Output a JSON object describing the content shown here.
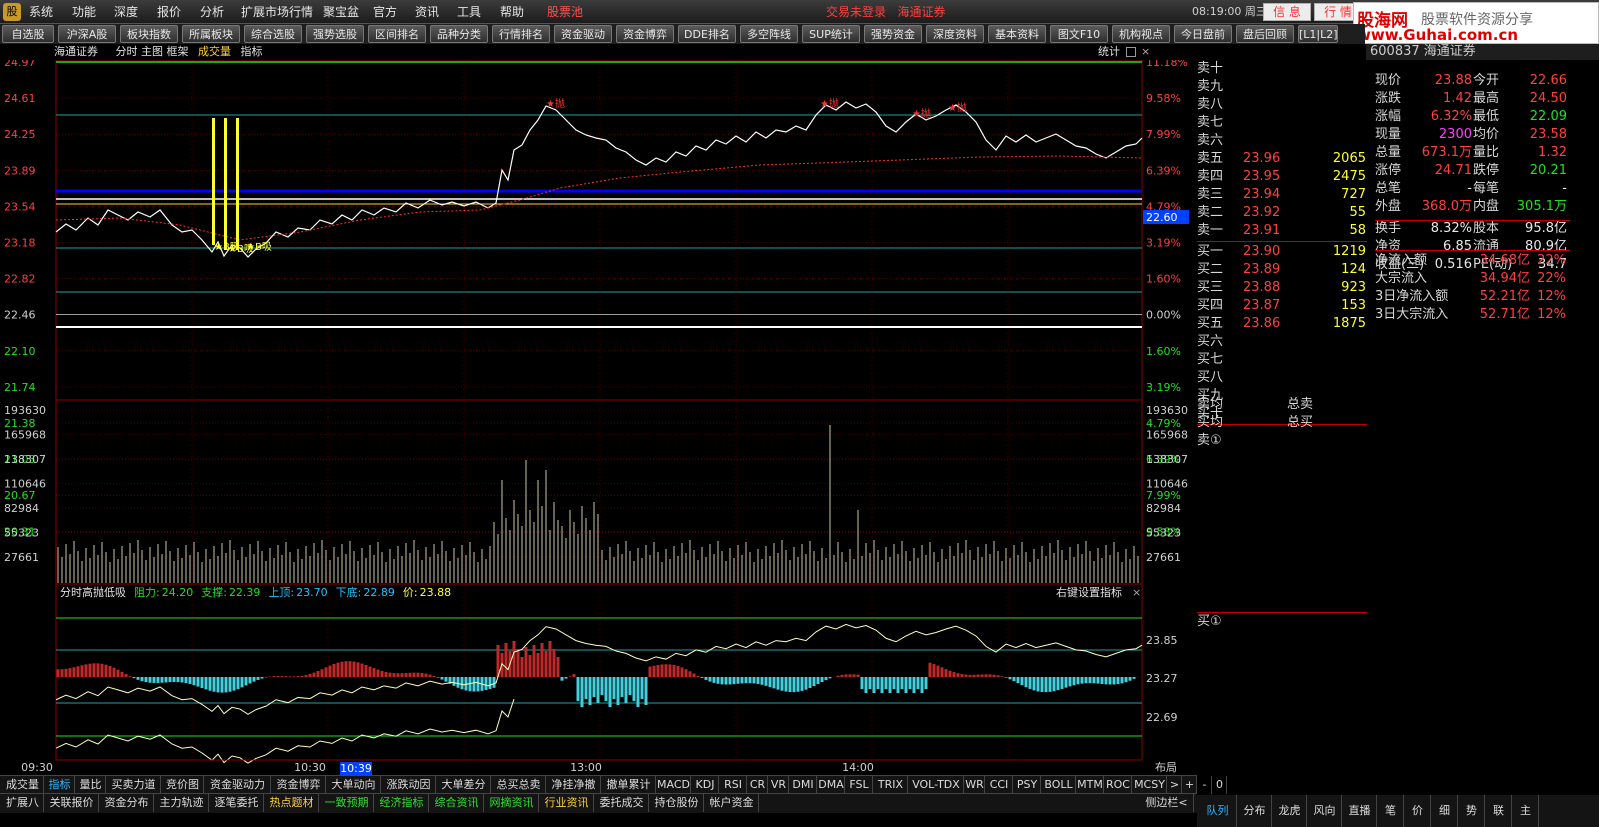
{
  "menubar": {
    "items": [
      "系统",
      "功能",
      "深度",
      "报价",
      "分析",
      "扩展市场行情",
      "聚宝盆",
      "官方",
      "资讯",
      "工具",
      "帮助",
      "股票池"
    ],
    "status": "交易未登录",
    "broker": "海通证券",
    "time": "08:19:00 周三",
    "buttons": [
      "信 息",
      "行 情"
    ]
  },
  "banner": {
    "line1": "股海网",
    "line2": "股票软件资源分享",
    "line3": "www.Guhai.com.cn"
  },
  "toolbar": {
    "items": [
      "自选股",
      "沪深A股",
      "板块指数",
      "所属板块",
      "综合选股",
      "强势选股",
      "区间排名",
      "品种分类",
      "行情排名",
      "资金驱动",
      "资金博弈",
      "DDE排名",
      "多空阵线",
      "SUP统计",
      "强势资金",
      "深度资料",
      "基本资料",
      "图文F10",
      "机构视点",
      "今日盘前",
      "盘后回顾",
      "[L1|L2]"
    ]
  },
  "chart": {
    "stock_name": "海通证券",
    "modes": "分时 主图 框架",
    "volume_label": "成交量",
    "indicator_label": "指标",
    "stat_label": "统计",
    "price_ticks": [
      "24.97",
      "24.61",
      "24.25",
      "23.89",
      "23.54",
      "23.18",
      "22.82",
      "22.46",
      "22.10",
      "21.74",
      "21.38",
      "21.03",
      "20.67",
      "20.31"
    ],
    "pct_ticks": [
      "11.18%",
      "9.58%",
      "7.99%",
      "6.39%",
      "4.79%",
      "3.19%",
      "1.60%",
      "0.00%",
      "1.60%",
      "3.19%",
      "4.79%",
      "6.39%",
      "7.99%",
      "9.58%"
    ],
    "current_price_tag": "22.60",
    "vol_ticks": [
      "193630",
      "165968",
      "138307",
      "110646",
      "82984",
      "55323",
      "27661"
    ],
    "time_ticks": [
      "09:30",
      "10:30",
      "13:00",
      "14:00"
    ],
    "cursor_time": "10:39",
    "layout_btn": "布局",
    "signals": {
      "buy": "B吸",
      "sell": "抛"
    }
  },
  "indicator": {
    "name": "分时高抛低吸",
    "resist_label": "阻力:",
    "resist": "24.20",
    "support_label": "支撑:",
    "support": "22.39",
    "top_label": "上顶:",
    "top": "23.70",
    "bottom_label": "下底:",
    "bottom": "22.89",
    "price_label": "价:",
    "price": "23.88",
    "right_label": "右键设置指标",
    "close": "×",
    "levels": [
      "23.85",
      "23.27",
      "22.69"
    ]
  },
  "orderbook": {
    "sell": [
      {
        "label": "卖十",
        "price": "",
        "vol": ""
      },
      {
        "label": "卖九",
        "price": "",
        "vol": ""
      },
      {
        "label": "卖八",
        "price": "",
        "vol": ""
      },
      {
        "label": "卖七",
        "price": "",
        "vol": ""
      },
      {
        "label": "卖六",
        "price": "",
        "vol": ""
      },
      {
        "label": "卖五",
        "price": "23.96",
        "vol": "2065"
      },
      {
        "label": "卖四",
        "price": "23.95",
        "vol": "2475"
      },
      {
        "label": "卖三",
        "price": "23.94",
        "vol": "727"
      },
      {
        "label": "卖二",
        "price": "23.92",
        "vol": "55"
      },
      {
        "label": "卖一",
        "price": "23.91",
        "vol": "58"
      }
    ],
    "buy": [
      {
        "label": "买一",
        "price": "23.90",
        "vol": "1219"
      },
      {
        "label": "买二",
        "price": "23.89",
        "vol": "124"
      },
      {
        "label": "买三",
        "price": "23.88",
        "vol": "923"
      },
      {
        "label": "买四",
        "price": "23.87",
        "vol": "153"
      },
      {
        "label": "买五",
        "price": "23.86",
        "vol": "1875"
      },
      {
        "label": "买六",
        "price": "",
        "vol": ""
      },
      {
        "label": "买七",
        "price": "",
        "vol": ""
      },
      {
        "label": "买八",
        "price": "",
        "vol": ""
      },
      {
        "label": "买九",
        "price": "",
        "vol": ""
      },
      {
        "label": "买十",
        "price": "",
        "vol": ""
      }
    ],
    "sell_avg_label": "卖均",
    "buy_avg_label": "买均",
    "sell_total_label": "总卖",
    "buy_total_label": "总买",
    "sell_queue": "卖①",
    "buy_queue": "买①"
  },
  "quote": {
    "header": "600837 海通证券",
    "rows": [
      [
        "现价",
        "23.88",
        "今开",
        "22.66"
      ],
      [
        "涨跌",
        "1.42",
        "最高",
        "24.50"
      ],
      [
        "涨幅",
        "6.32%",
        "最低",
        "22.09"
      ],
      [
        "现量",
        "2300",
        "均价",
        "23.58"
      ],
      [
        "总量",
        "673.1万",
        "量比",
        "1.32"
      ],
      [
        "涨停",
        "24.71",
        "跌停",
        "20.21"
      ],
      [
        "总笔",
        "-",
        "每笔",
        "-"
      ],
      [
        "外盘",
        "368.0万",
        "内盘",
        "305.1万"
      ],
      [
        "换手",
        "8.32%",
        "股本",
        "95.8亿"
      ],
      [
        "净资",
        "6.85",
        "流通",
        "80.9亿"
      ],
      [
        "收益(三)",
        "0.516",
        "PE(动)",
        "34.7"
      ]
    ],
    "colors": {
      "up": "#ff4040",
      "down": "#20e020",
      "neutral": "#e8e8e8",
      "vol": "#ff40ff",
      "lim_up": "#ff4040",
      "lim_down": "#20e020"
    }
  },
  "flow": [
    [
      "净流入额",
      "34.68亿",
      "22%"
    ],
    [
      "大宗流入",
      "34.94亿",
      "22%"
    ],
    [
      "3日净流入额",
      "52.21亿",
      "12%"
    ],
    [
      "3日大宗流入",
      "52.71亿",
      "12%"
    ]
  ],
  "bottom_tabs_1": [
    "成交量",
    "指标",
    "量比",
    "买卖力道",
    "竞价图",
    "资金驱动力",
    "资金博弈",
    "大单动向",
    "涨跌动因",
    "大单差分",
    "总买总卖",
    "净挂净撤",
    "撤单累计",
    "MACD",
    "KDJ",
    "RSI",
    "CR",
    "VR",
    "DMI",
    "DMA",
    "FSL",
    "TRIX",
    "VOL-TDX",
    "WR",
    "CCI",
    "PSY",
    "BOLL",
    "MTM",
    "ROC",
    "MCSY",
    ">",
    "+",
    "-",
    "0"
  ],
  "bottom_tabs_2": [
    "扩展八",
    "关联报价",
    "资金分布",
    "主力轨迹",
    "逐笔委托",
    "热点题材",
    "一致预期",
    "经济指标",
    "综合资讯",
    "网摘资讯",
    "行业资讯",
    "委托成交",
    "持仓股份",
    "帐户资金",
    "侧边栏<"
  ],
  "side_tabs": [
    "队列",
    "分布",
    "龙虎",
    "风向",
    "直播",
    "笔",
    "价",
    "细",
    "势",
    "联",
    "主"
  ]
}
